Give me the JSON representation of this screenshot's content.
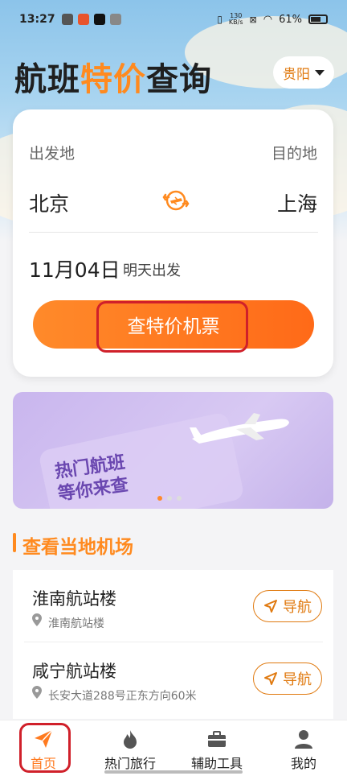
{
  "status": {
    "time": "13:27",
    "net_top": "130",
    "net_bottom": "KB/s",
    "battery": "61%"
  },
  "header": {
    "title_prefix": "航班",
    "title_highlight": "特价",
    "title_suffix": "查询",
    "city": "贵阳"
  },
  "search": {
    "from_label": "出发地",
    "to_label": "目的地",
    "from_city": "北京",
    "to_city": "上海",
    "date": "11月04日",
    "date_hint": "明天出发",
    "button": "查特价机票"
  },
  "banner": {
    "line1": "热门航班",
    "line2": "等你来查",
    "page_count": 3,
    "active_page": 0
  },
  "airports": {
    "section_title": "查看当地机场",
    "nav_label": "导航",
    "items": [
      {
        "name": "淮南航站楼",
        "address": "淮南航站楼"
      },
      {
        "name": "咸宁航站楼",
        "address": "长安大道288号正东方向60米"
      }
    ]
  },
  "tabs": [
    {
      "label": "首页",
      "icon": "paper-plane-icon",
      "active": true
    },
    {
      "label": "热门旅行",
      "icon": "flame-icon",
      "active": false
    },
    {
      "label": "辅助工具",
      "icon": "toolbox-icon",
      "active": false
    },
    {
      "label": "我的",
      "icon": "user-icon",
      "active": false
    }
  ],
  "colors": {
    "accent": "#ff8a1f",
    "highlight_box": "#d0202a",
    "banner_text": "#6a47b0"
  }
}
